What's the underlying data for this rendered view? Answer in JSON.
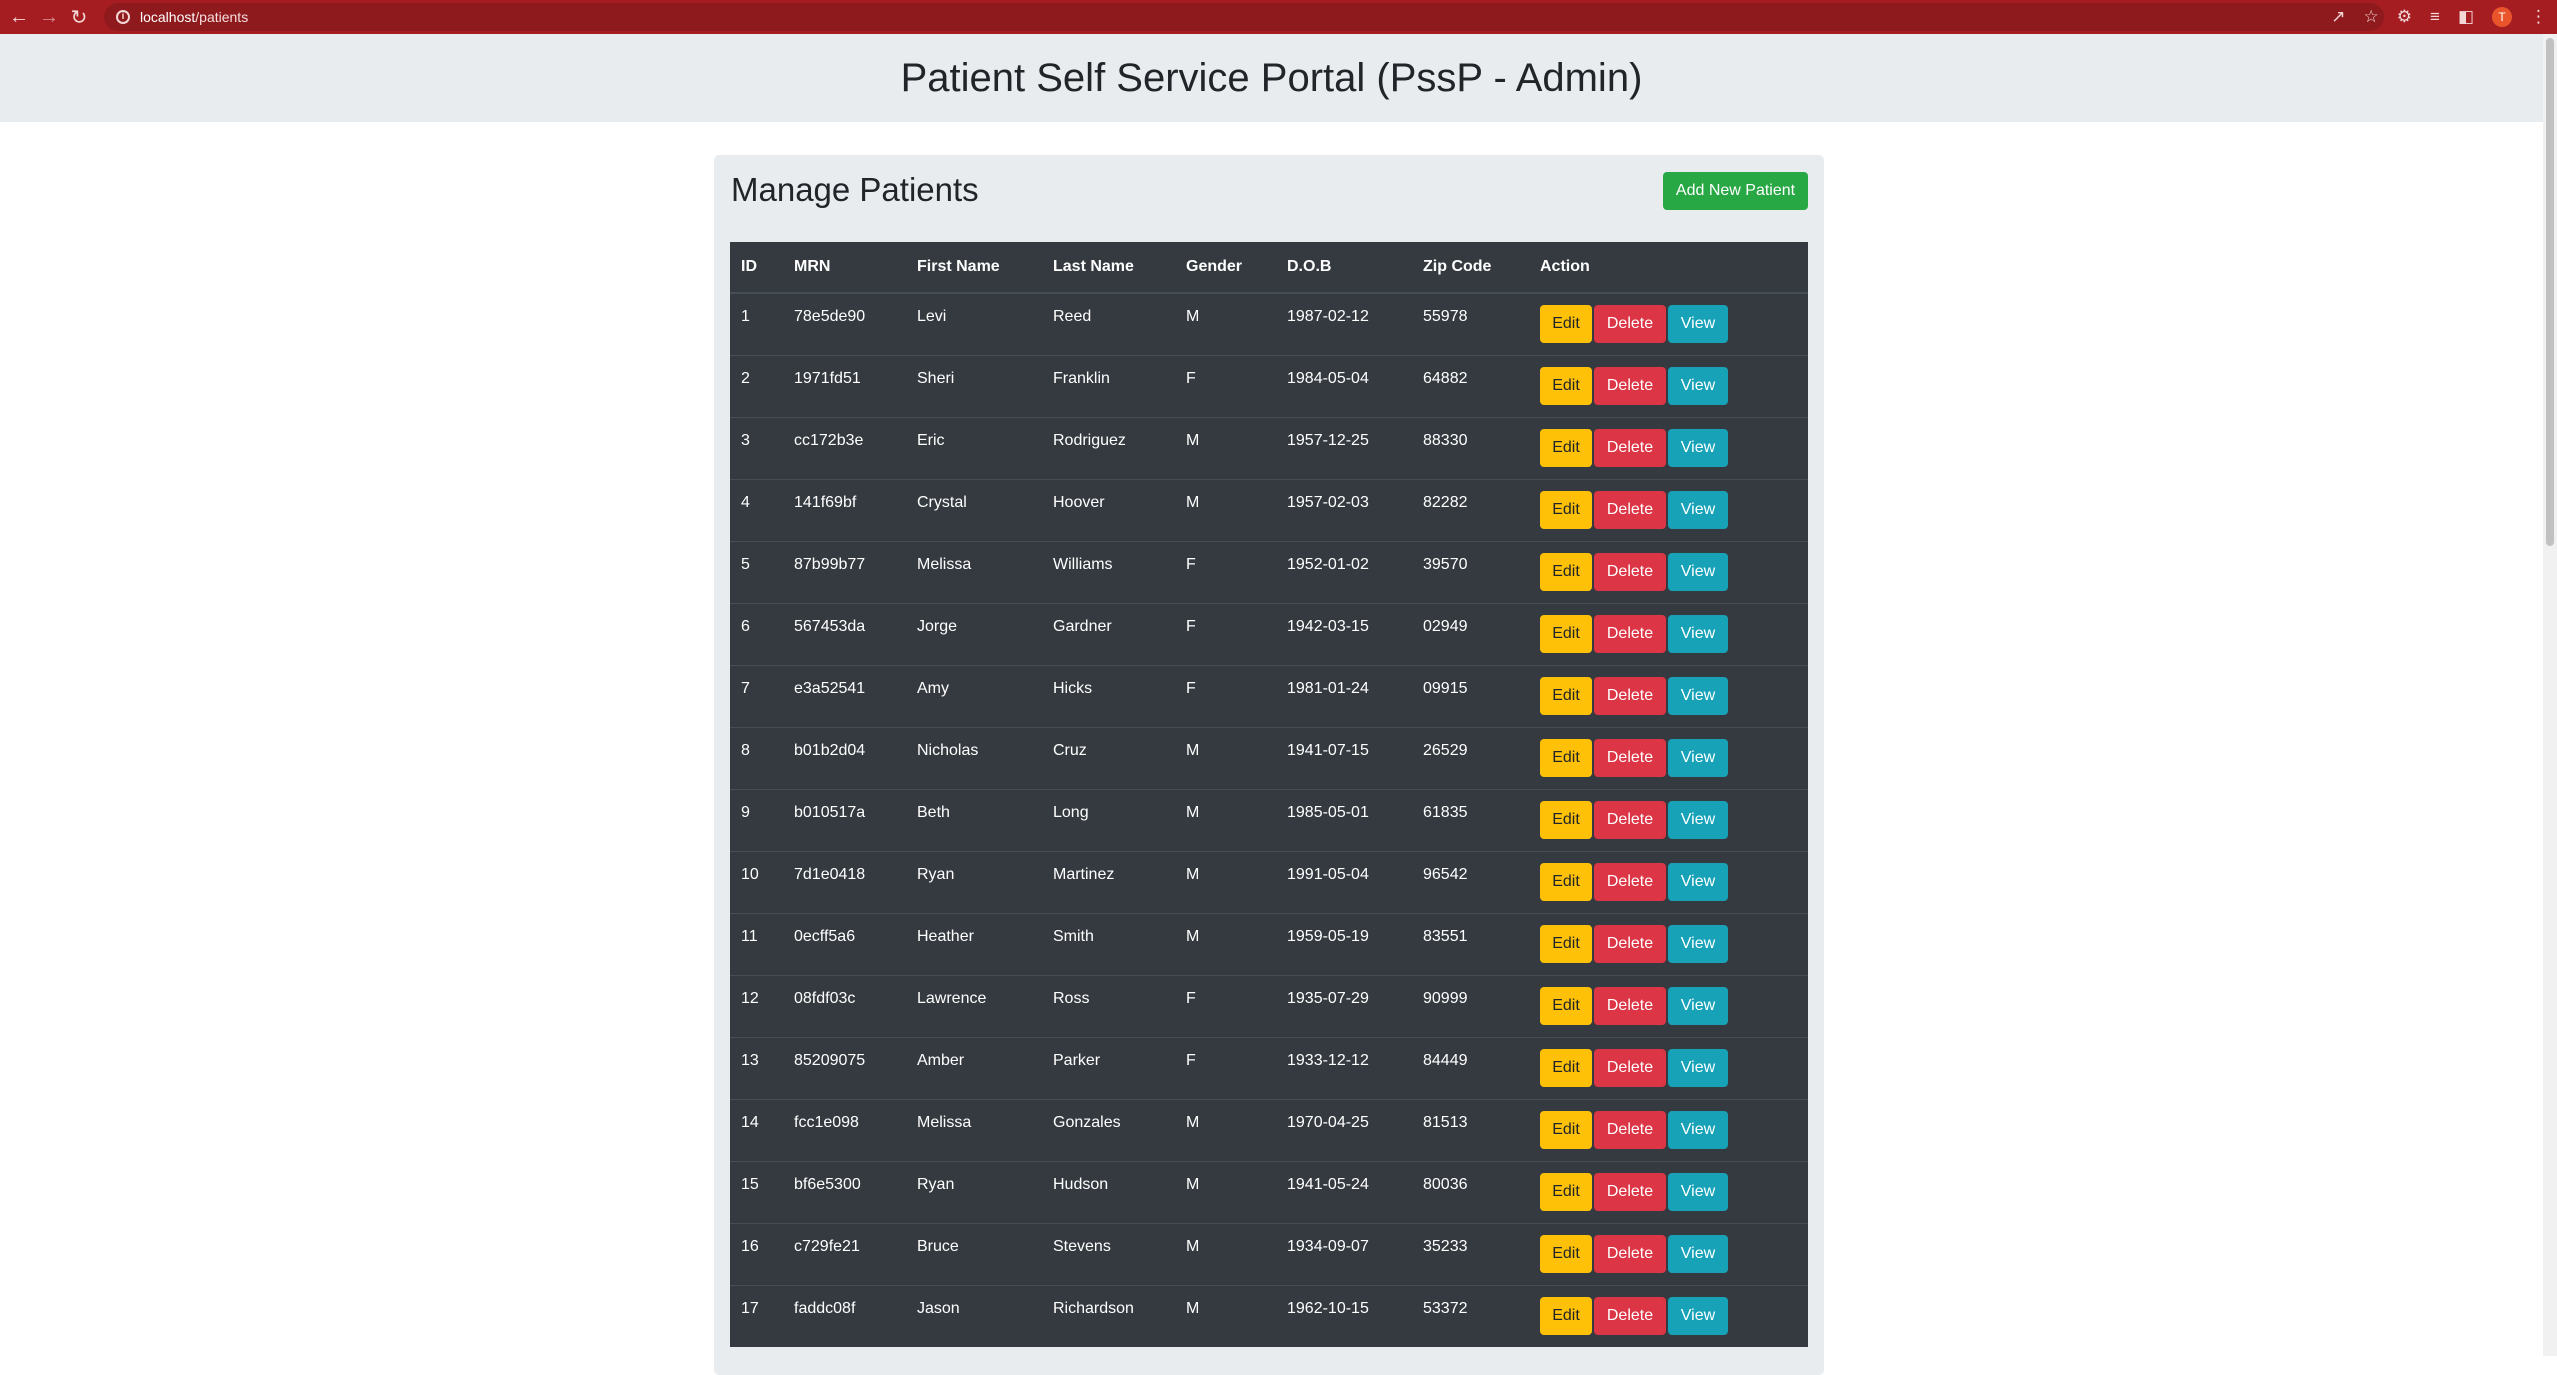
{
  "browser": {
    "url_host": "localhost",
    "url_path": "/patients",
    "profile_initial": "T"
  },
  "header": {
    "title": "Patient Self Service Portal (PssP - Admin)"
  },
  "card": {
    "title": "Manage Patients",
    "add_button": "Add New Patient"
  },
  "table": {
    "columns": [
      "ID",
      "MRN",
      "First Name",
      "Last Name",
      "Gender",
      "D.O.B",
      "Zip Code",
      "Action"
    ],
    "actions": {
      "edit": "Edit",
      "delete": "Delete",
      "view": "View"
    },
    "rows": [
      {
        "id": "1",
        "mrn": "78e5de90",
        "first": "Levi",
        "last": "Reed",
        "gender": "M",
        "dob": "1987-02-12",
        "zip": "55978"
      },
      {
        "id": "2",
        "mrn": "1971fd51",
        "first": "Sheri",
        "last": "Franklin",
        "gender": "F",
        "dob": "1984-05-04",
        "zip": "64882"
      },
      {
        "id": "3",
        "mrn": "cc172b3e",
        "first": "Eric",
        "last": "Rodriguez",
        "gender": "M",
        "dob": "1957-12-25",
        "zip": "88330"
      },
      {
        "id": "4",
        "mrn": "141f69bf",
        "first": "Crystal",
        "last": "Hoover",
        "gender": "M",
        "dob": "1957-02-03",
        "zip": "82282"
      },
      {
        "id": "5",
        "mrn": "87b99b77",
        "first": "Melissa",
        "last": "Williams",
        "gender": "F",
        "dob": "1952-01-02",
        "zip": "39570"
      },
      {
        "id": "6",
        "mrn": "567453da",
        "first": "Jorge",
        "last": "Gardner",
        "gender": "F",
        "dob": "1942-03-15",
        "zip": "02949"
      },
      {
        "id": "7",
        "mrn": "e3a52541",
        "first": "Amy",
        "last": "Hicks",
        "gender": "F",
        "dob": "1981-01-24",
        "zip": "09915"
      },
      {
        "id": "8",
        "mrn": "b01b2d04",
        "first": "Nicholas",
        "last": "Cruz",
        "gender": "M",
        "dob": "1941-07-15",
        "zip": "26529"
      },
      {
        "id": "9",
        "mrn": "b010517a",
        "first": "Beth",
        "last": "Long",
        "gender": "M",
        "dob": "1985-05-01",
        "zip": "61835"
      },
      {
        "id": "10",
        "mrn": "7d1e0418",
        "first": "Ryan",
        "last": "Martinez",
        "gender": "M",
        "dob": "1991-05-04",
        "zip": "96542"
      },
      {
        "id": "11",
        "mrn": "0ecff5a6",
        "first": "Heather",
        "last": "Smith",
        "gender": "M",
        "dob": "1959-05-19",
        "zip": "83551"
      },
      {
        "id": "12",
        "mrn": "08fdf03c",
        "first": "Lawrence",
        "last": "Ross",
        "gender": "F",
        "dob": "1935-07-29",
        "zip": "90999"
      },
      {
        "id": "13",
        "mrn": "85209075",
        "first": "Amber",
        "last": "Parker",
        "gender": "F",
        "dob": "1933-12-12",
        "zip": "84449"
      },
      {
        "id": "14",
        "mrn": "fcc1e098",
        "first": "Melissa",
        "last": "Gonzales",
        "gender": "M",
        "dob": "1970-04-25",
        "zip": "81513"
      },
      {
        "id": "15",
        "mrn": "bf6e5300",
        "first": "Ryan",
        "last": "Hudson",
        "gender": "M",
        "dob": "1941-05-24",
        "zip": "80036"
      },
      {
        "id": "16",
        "mrn": "c729fe21",
        "first": "Bruce",
        "last": "Stevens",
        "gender": "M",
        "dob": "1934-09-07",
        "zip": "35233"
      },
      {
        "id": "17",
        "mrn": "faddc08f",
        "first": "Jason",
        "last": "Richardson",
        "gender": "M",
        "dob": "1962-10-15",
        "zip": "53372"
      }
    ]
  },
  "colors": {
    "chrome": "#a51d21",
    "header_bg": "#e9ecef",
    "table_bg": "#343a40",
    "edit": "#ffc107",
    "delete": "#dc3545",
    "view": "#17a2b8",
    "add": "#28a745"
  },
  "icons": [
    "back-icon",
    "forward-icon",
    "reload-icon",
    "info-icon",
    "share-icon",
    "star-icon",
    "extensions-icon",
    "reading-list-icon",
    "side-panel-icon",
    "menu-icon"
  ]
}
